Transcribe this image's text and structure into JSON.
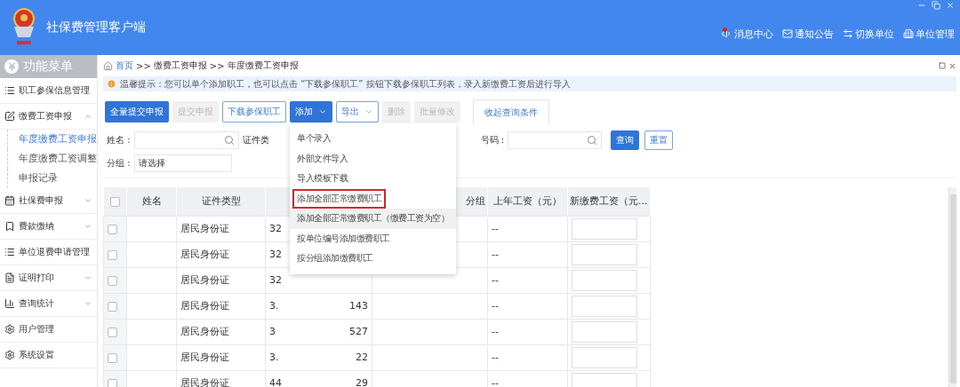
{
  "window": {
    "title": "社保费管理客户端"
  },
  "header_links": [
    {
      "label": "消息中心",
      "unread": true
    },
    {
      "label": "通知公告"
    },
    {
      "label": "切换单位"
    },
    {
      "label": "单位管理"
    }
  ],
  "sidebar": {
    "title": "功能菜单",
    "items": [
      {
        "label": "职工参保信息管理"
      },
      {
        "label": "缴费工资申报",
        "expanded": true,
        "children": [
          {
            "label": "年度缴费工资申报",
            "selected": true
          },
          {
            "label": "年度缴费工资调整",
            "selected": false
          },
          {
            "label": "申报记录",
            "selected": false
          }
        ]
      },
      {
        "label": "社保费申报",
        "expanded": false
      },
      {
        "label": "费款缴纳",
        "expanded": false
      },
      {
        "label": "单位退费申请管理"
      },
      {
        "label": "证明打印",
        "expanded": false
      },
      {
        "label": "查询统计",
        "expanded": false
      },
      {
        "label": "用户管理"
      },
      {
        "label": "系统设置"
      }
    ]
  },
  "breadcrumb": [
    "首页",
    "缴费工资申报",
    "年度缴费工资申报"
  ],
  "breadcrumb_separator": ">>",
  "tip": "温馨提示：您可以单个添加职工，也可以点击 “下载参保职工” 按钮下载参保职工列表，录入新缴费工资后进行导入",
  "toolbar": [
    {
      "label": "全量提交申报",
      "kind": "primary"
    },
    {
      "label": "提交申报",
      "kind": "disabled"
    },
    {
      "label": "下载参保职工",
      "kind": "outline"
    },
    {
      "label": "添加",
      "kind": "primary",
      "caret": true,
      "menu_open": true
    },
    {
      "label": "导出",
      "kind": "outline",
      "caret": true,
      "menu_open": false
    },
    {
      "label": "删除",
      "kind": "disabled"
    },
    {
      "label": "批量修改",
      "kind": "disabled"
    },
    {
      "label": "收起查询条件",
      "kind": "tab"
    }
  ],
  "add_menu": [
    {
      "label": "单个录入",
      "outlined": false,
      "hovered": false
    },
    {
      "label": "外部文件导入",
      "outlined": false,
      "hovered": false
    },
    {
      "label": "导入模板下载",
      "outlined": false,
      "hovered": false
    },
    {
      "label": "添加全部正常缴费职工",
      "outlined": true,
      "hovered": false
    },
    {
      "label": "添加全部正常缴费职工（缴费工资为空）",
      "outlined": false,
      "hovered": true
    },
    {
      "label": "按单位编号添加缴费职工",
      "outlined": false,
      "hovered": false
    },
    {
      "label": "按分组添加缴费职工",
      "outlined": false,
      "hovered": false
    }
  ],
  "search": {
    "name_label": "姓名 :",
    "id_type_label": "证件类",
    "id_no_label": "号码 :",
    "group_label": "分组 :",
    "group_value": "请选择",
    "query": "查询",
    "reset": "重置"
  },
  "table": {
    "header_checked": false,
    "columns": [
      {
        "kind": "check"
      },
      {
        "kind": "text",
        "label": "姓名"
      },
      {
        "kind": "text",
        "label": "证件类型"
      },
      {
        "kind": "text"
      },
      {
        "kind": "text",
        "label": "分组"
      },
      {
        "kind": "text",
        "label": "上年工资（元）"
      },
      {
        "kind": "input",
        "label": "新缴费工资（元..."
      }
    ],
    "rows": [
      {
        "checked": false,
        "id_type": "居民身份证",
        "id_start": "32",
        "prior_wage": "--"
      },
      {
        "checked": false,
        "id_type": "居民身份证",
        "id_start": "32",
        "prior_wage": "--"
      },
      {
        "checked": false,
        "id_type": "居民身份证",
        "id_start": "32",
        "prior_wage": "--"
      },
      {
        "checked": false,
        "id_type": "居民身份证",
        "id_start": "3.",
        "id_end": "143",
        "prior_wage": "--"
      },
      {
        "checked": false,
        "id_type": "居民身份证",
        "id_start": "3",
        "id_end": "527",
        "prior_wage": "--"
      },
      {
        "checked": false,
        "id_type": "居民身份证",
        "id_start": "3.",
        "id_end": "22",
        "prior_wage": "--"
      },
      {
        "checked": false,
        "id_type": "居民身份证",
        "id_start": "44",
        "id_end": "29",
        "prior_wage": "--"
      }
    ]
  }
}
